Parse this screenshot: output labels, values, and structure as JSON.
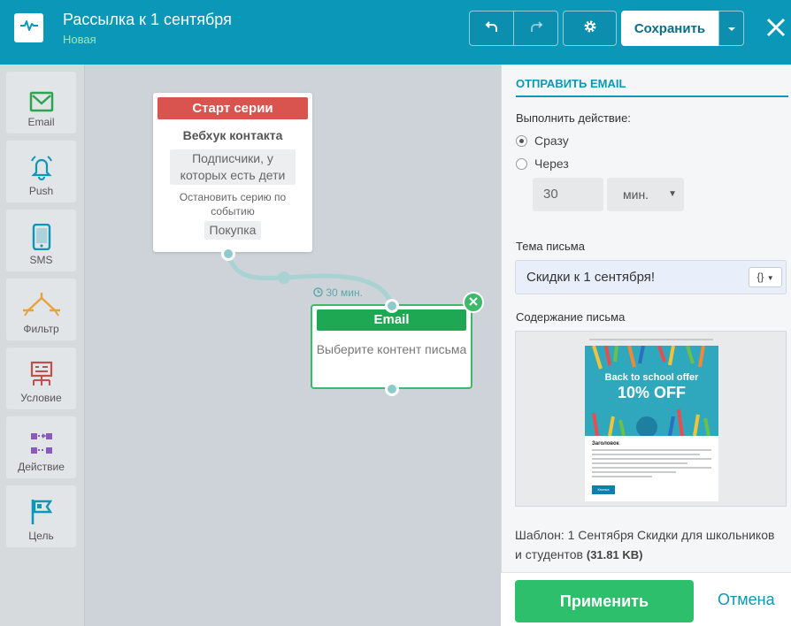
{
  "header": {
    "title": "Рассылка к 1 сентября",
    "status": "Новая",
    "save_label": "Сохранить",
    "colors": {
      "bar": "#0a97b8",
      "status": "#9ee6b5"
    }
  },
  "sidebar": {
    "items": [
      {
        "label": "Email",
        "icon": "mail-icon",
        "color": "#2ea44f"
      },
      {
        "label": "Push",
        "icon": "bell-icon",
        "color": "#0a97b8"
      },
      {
        "label": "SMS",
        "icon": "phone-icon",
        "color": "#0a97b8"
      },
      {
        "label": "Фильтр",
        "icon": "filter-icon",
        "color": "#e8a23a"
      },
      {
        "label": "Условие",
        "icon": "condition-icon",
        "color": "#c0504d"
      },
      {
        "label": "Действие",
        "icon": "action-icon",
        "color": "#8a5ab8"
      },
      {
        "label": "Цель",
        "icon": "flag-icon",
        "color": "#0a97b8"
      }
    ]
  },
  "canvas": {
    "start_node": {
      "header": "Старт серии",
      "title": "Вебхук контакта",
      "segment": "Подписчики, у которых есть дети",
      "stop_text": "Остановить серию по событию",
      "stop_event": "Покупка"
    },
    "delay_label": "30 мин.",
    "email_node": {
      "header": "Email",
      "body": "Выберите контент письма"
    }
  },
  "panel": {
    "title": "ОТПРАВИТЬ EMAIL",
    "action_label": "Выполнить действие:",
    "option_now": "Сразу",
    "option_after": "Через",
    "selected_option": "Сразу",
    "delay_value": "30",
    "delay_unit": "мин.",
    "subject_label": "Тема письма",
    "subject_value": "Скидки к 1 сентября!",
    "subject_vars": "{}",
    "content_label": "Содержание письма",
    "preview": {
      "offer_line1": "Back to school offer",
      "offer_line2": "10% OFF",
      "heading": "Заголовок",
      "button": "Кнопка"
    },
    "template_prefix": "Шаблон: 1 Сентября Скидки для школьников и студентов",
    "template_size": "(31.81 KB)",
    "apply_label": "Применить",
    "cancel_label": "Отмена"
  }
}
